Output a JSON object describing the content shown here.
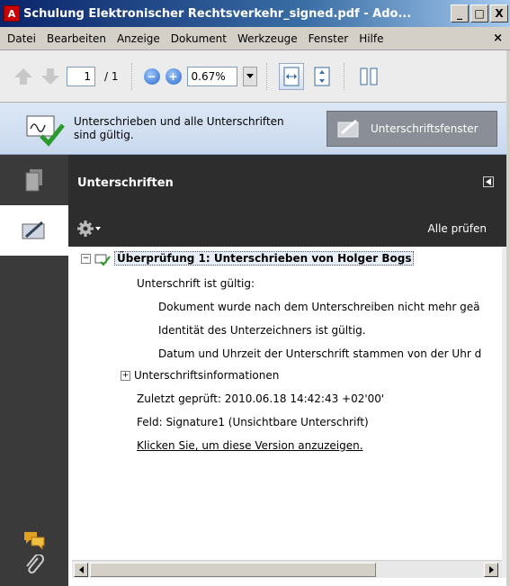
{
  "window": {
    "title": "Schulung Elektronischer Rechtsverkehr_signed.pdf - Ado...",
    "minimize_label": "_",
    "maximize_label": "□",
    "close_label": "X"
  },
  "menubar": {
    "items": [
      "Datei",
      "Bearbeiten",
      "Anzeige",
      "Dokument",
      "Werkzeuge",
      "Fenster",
      "Hilfe"
    ],
    "close_label": "×"
  },
  "toolbar": {
    "page_current": "1",
    "page_total": "/ 1",
    "zoom_out_label": "−",
    "zoom_in_label": "+",
    "zoom_value": "0.67%"
  },
  "signature_bar": {
    "message": "Unterschrieben und alle Unterschriften sind gültig.",
    "panel_button_label": "Unterschriftsfenster"
  },
  "panel": {
    "title": "Unterschriften",
    "validate_all_label": "Alle prüfen",
    "signature": {
      "title": "Überprüfung 1: Unterschrieben von Holger Bogs",
      "status": "Unterschrift ist gültig:",
      "details": [
        "Dokument wurde nach dem Unterschreiben nicht mehr geä",
        "Identität des Unterzeichners ist gültig.",
        "Datum und Uhrzeit der Unterschrift stammen von der Uhr d"
      ],
      "info_label": "Unterschriftsinformationen",
      "last_checked": "Zuletzt geprüft: 2010.06.18 14:42:43 +02'00'",
      "field": "Feld: Signature1 (Unsichtbare Unterschrift)",
      "view_version_link": "Klicken Sie, um diese Version anzuzeigen."
    }
  },
  "colors": {
    "title_bar": "#0a246a",
    "sig_bar": "#dce7f5",
    "dark_panel": "#2d2d2d",
    "left_nav": "#3a3a3a"
  }
}
